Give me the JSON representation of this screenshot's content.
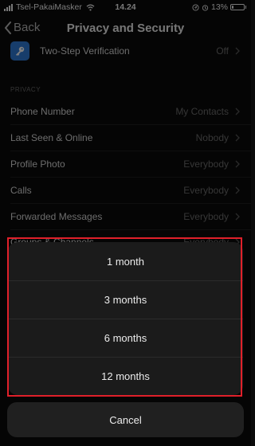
{
  "status_bar": {
    "carrier": "Tsel-PakaiMasker",
    "time": "14.24",
    "battery_percent": "13%",
    "battery_level": 0.13
  },
  "nav": {
    "back_label": "Back",
    "title": "Privacy and Security"
  },
  "two_step": {
    "label": "Two-Step Verification",
    "value": "Off",
    "icon": "key-icon",
    "icon_color": "#2f7bd6"
  },
  "privacy_section": {
    "header": "PRIVACY",
    "items": [
      {
        "label": "Phone Number",
        "value": "My Contacts"
      },
      {
        "label": "Last Seen & Online",
        "value": "Nobody"
      },
      {
        "label": "Profile Photo",
        "value": "Everybody"
      },
      {
        "label": "Calls",
        "value": "Everybody"
      },
      {
        "label": "Forwarded Messages",
        "value": "Everybody"
      },
      {
        "label": "Groups & Channels",
        "value": "Everybody"
      }
    ]
  },
  "action_sheet": {
    "options": [
      "1 month",
      "3 months",
      "6 months",
      "12 months"
    ],
    "cancel_label": "Cancel",
    "highlight_color": "#e0202a"
  }
}
